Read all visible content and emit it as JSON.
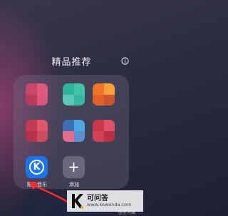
{
  "folder": {
    "title": "精品推荐",
    "info_icon": "info-icon",
    "apps": [
      {
        "label": "酷狗音乐",
        "icon": "kugou-music-icon",
        "color": "#1b74ef",
        "glyph": "K"
      },
      {
        "label": "添加",
        "icon": "plus-icon",
        "glyph": "+"
      }
    ],
    "blurred_tiles": [
      {
        "colors": [
          "#c9466a",
          "#e0587a",
          "#b83a5c",
          "#d9577a"
        ]
      },
      {
        "colors": [
          "#2fb39c",
          "#41c4a6",
          "#5ac9b5",
          "#3ab89f"
        ]
      },
      {
        "colors": [
          "#f0732a",
          "#f5a23a",
          "#e0612a",
          "#c9542f"
        ]
      },
      {
        "colors": [
          "#c23a52",
          "#e05568",
          "#b5334a",
          "#d04a5e"
        ]
      },
      {
        "colors": [
          "#3f6fb6",
          "#4aa9e0",
          "#e56c8a",
          "#5a8fd0"
        ]
      },
      {
        "colors": [
          "#c9384a",
          "#e0506a",
          "#d04256",
          "#b83044"
        ]
      }
    ]
  },
  "watermark": {
    "logo": "k-logo-icon",
    "title": "可问答",
    "url": "www.kewenda.com",
    "handle": "@星河编"
  }
}
